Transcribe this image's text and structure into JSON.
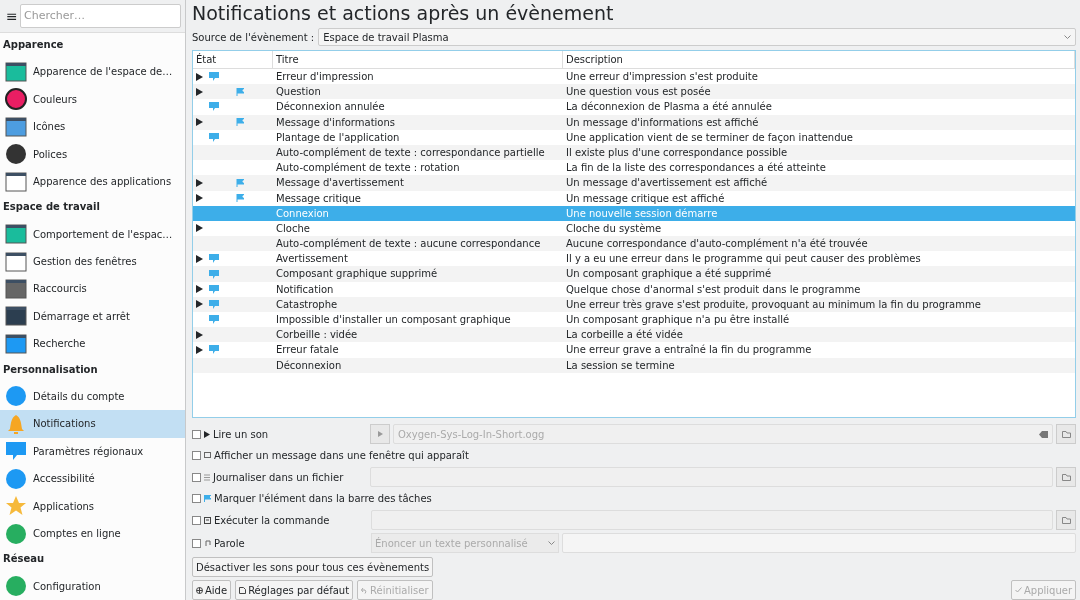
{
  "sidebar": {
    "search": {
      "placeholder": "Chercher…"
    },
    "menu_glyph": "≡",
    "sections": [
      {
        "title": "Apparence",
        "items": [
          {
            "label": "Apparence de l'espace de…",
            "selected": false
          },
          {
            "label": "Couleurs",
            "selected": false
          },
          {
            "label": "Icônes",
            "selected": false
          },
          {
            "label": "Polices",
            "selected": false
          },
          {
            "label": "Apparence des applications",
            "selected": false
          }
        ]
      },
      {
        "title": "Espace de travail",
        "items": [
          {
            "label": "Comportement de l'espac…",
            "selected": false
          },
          {
            "label": "Gestion des fenêtres",
            "selected": false
          },
          {
            "label": "Raccourcis",
            "selected": false
          },
          {
            "label": "Démarrage et arrêt",
            "selected": false
          },
          {
            "label": "Recherche",
            "selected": false
          }
        ]
      },
      {
        "title": "Personnalisation",
        "items": [
          {
            "label": "Détails du compte",
            "selected": false
          },
          {
            "label": "Notifications",
            "selected": true
          },
          {
            "label": "Paramètres régionaux",
            "selected": false
          },
          {
            "label": "Accessibilité",
            "selected": false
          },
          {
            "label": "Applications",
            "selected": false
          },
          {
            "label": "Comptes en ligne",
            "selected": false
          }
        ]
      },
      {
        "title": "Réseau",
        "items": [
          {
            "label": "Configuration",
            "selected": false
          }
        ]
      }
    ]
  },
  "page": {
    "title": "Notifications et actions après un évènement",
    "source_label": "Source de l'évènement :",
    "source_value": "Espace de travail Plasma"
  },
  "table": {
    "columns": [
      "État",
      "Titre",
      "Description"
    ],
    "rows": [
      {
        "sound": true,
        "popup": true,
        "taskbar": false,
        "selected": false,
        "title": "Erreur d'impression",
        "description": "Une erreur d'impression s'est produite"
      },
      {
        "sound": true,
        "popup": false,
        "taskbar": true,
        "selected": false,
        "title": "Question",
        "description": "Une question vous est posée"
      },
      {
        "sound": false,
        "popup": true,
        "taskbar": false,
        "selected": false,
        "title": "Déconnexion annulée",
        "description": "La déconnexion de Plasma a été annulée"
      },
      {
        "sound": true,
        "popup": false,
        "taskbar": true,
        "selected": false,
        "title": "Message d'informations",
        "description": "Un message d'informations est affiché"
      },
      {
        "sound": false,
        "popup": true,
        "taskbar": false,
        "selected": false,
        "title": "Plantage de l'application",
        "description": "Une application vient de se terminer de façon inattendue"
      },
      {
        "sound": false,
        "popup": false,
        "taskbar": false,
        "selected": false,
        "title": "Auto-complément de texte : correspondance partielle",
        "description": "Il existe plus d'une correspondance possible"
      },
      {
        "sound": false,
        "popup": false,
        "taskbar": false,
        "selected": false,
        "title": "Auto-complément de texte : rotation",
        "description": "La fin de la liste des correspondances a été atteinte"
      },
      {
        "sound": true,
        "popup": false,
        "taskbar": true,
        "selected": false,
        "title": "Message d'avertissement",
        "description": "Un message d'avertissement est affiché"
      },
      {
        "sound": true,
        "popup": false,
        "taskbar": true,
        "selected": false,
        "title": "Message critique",
        "description": "Un message critique est affiché"
      },
      {
        "sound": false,
        "popup": false,
        "taskbar": false,
        "selected": true,
        "title": "Connexion",
        "description": "Une nouvelle session démarre"
      },
      {
        "sound": true,
        "popup": false,
        "taskbar": false,
        "selected": false,
        "title": "Cloche",
        "description": "Cloche du système"
      },
      {
        "sound": false,
        "popup": false,
        "taskbar": false,
        "selected": false,
        "title": "Auto-complément de texte : aucune correspondance",
        "description": "Aucune correspondance d'auto-complément n'a été trouvée"
      },
      {
        "sound": true,
        "popup": true,
        "taskbar": false,
        "selected": false,
        "title": "Avertissement",
        "description": "Il y a eu une erreur dans le programme qui peut causer des problèmes"
      },
      {
        "sound": false,
        "popup": true,
        "taskbar": false,
        "selected": false,
        "title": "Composant graphique supprimé",
        "description": "Un composant graphique a été supprimé"
      },
      {
        "sound": true,
        "popup": true,
        "taskbar": false,
        "selected": false,
        "title": "Notification",
        "description": "Quelque chose d'anormal s'est produit dans le programme"
      },
      {
        "sound": true,
        "popup": true,
        "taskbar": false,
        "selected": false,
        "title": "Catastrophe",
        "description": "Une erreur très grave s'est produite, provoquant au minimum la fin du programme"
      },
      {
        "sound": false,
        "popup": true,
        "taskbar": false,
        "selected": false,
        "title": "Impossible d'installer un composant graphique",
        "description": "Un composant graphique n'a pu être installé"
      },
      {
        "sound": true,
        "popup": false,
        "taskbar": false,
        "selected": false,
        "title": "Corbeille : vidée",
        "description": "La corbeille a été vidée"
      },
      {
        "sound": true,
        "popup": true,
        "taskbar": false,
        "selected": false,
        "title": "Erreur fatale",
        "description": "Une erreur grave a entraîné la fin du programme"
      },
      {
        "sound": false,
        "popup": false,
        "taskbar": false,
        "selected": false,
        "title": "Déconnexion",
        "description": "La session se termine"
      }
    ]
  },
  "actions": [
    {
      "kind": "sound",
      "label": "Lire un son",
      "checked": false,
      "value": "Oxygen-Sys-Log-In-Short.ogg"
    },
    {
      "kind": "popup",
      "label": "Afficher un message dans une fenêtre qui apparaît",
      "checked": false
    },
    {
      "kind": "file",
      "label": "Journaliser dans un fichier",
      "checked": false
    },
    {
      "kind": "taskbar",
      "label": "Marquer l'élément dans la barre des tâches",
      "checked": false
    },
    {
      "kind": "command",
      "label": "Exécuter la commande",
      "checked": false
    },
    {
      "kind": "speech",
      "label": "Parole",
      "checked": false,
      "value": "Énoncer un texte personnalisé"
    }
  ],
  "mute_button": "Désactiver les sons pour tous ces évènements",
  "buttons": [
    {
      "label": "Aide",
      "disabled": false
    },
    {
      "label": "Réglages par défaut",
      "disabled": false
    },
    {
      "label": "Réinitialiser",
      "disabled": true
    },
    {
      "label": "Appliquer",
      "disabled": true
    }
  ]
}
